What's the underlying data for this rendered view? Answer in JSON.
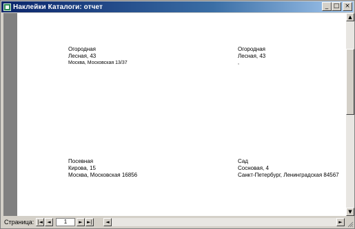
{
  "window": {
    "title": "Наклейки Каталоги: отчет",
    "buttons": {
      "minimize": "_",
      "maximize": "□",
      "close": "×"
    }
  },
  "labels": [
    {
      "line1": "Огородная",
      "line2": "Лесная, 43",
      "line3": "Москва, Московская 13/37"
    },
    {
      "line1": "Огородная",
      "line2": "Лесная, 43",
      "line3": ","
    },
    {
      "line1": "Посевная",
      "line2": "Кирова, 15",
      "line3": "Москва, Московская 16856"
    },
    {
      "line1": "Сад",
      "line2": "Сосновая, 4",
      "line3": "Санкт-Петербург, Ленинградская 84567"
    }
  ],
  "navigation": {
    "page_label": "Страница:",
    "current_page": "1",
    "first_icon": "first-record-icon",
    "prev_icon": "previous-record-icon",
    "next_icon": "next-record-icon",
    "last_icon": "last-record-icon"
  },
  "scrollbars": {
    "up": "▲",
    "down": "▼",
    "left": "◄",
    "right": "►"
  },
  "nav_glyphs": {
    "first": "|◄",
    "prev": "◄",
    "next": "►",
    "last": "►|"
  }
}
